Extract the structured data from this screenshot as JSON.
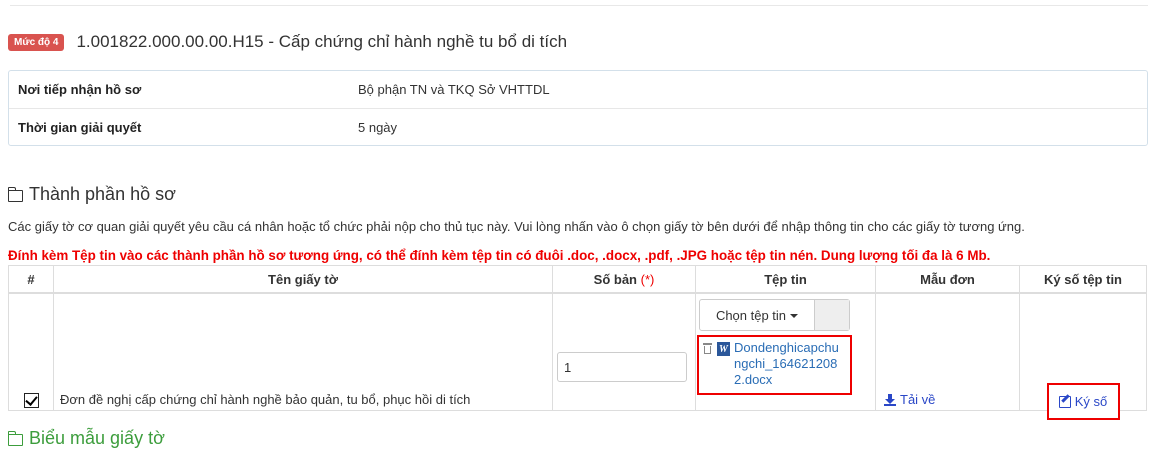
{
  "level_badge": "Mức độ 4",
  "procedure_title": "1.001822.000.00.00.H15 - Cấp chứng chỉ hành nghề tu bổ di tích",
  "info": [
    {
      "label": "Nơi tiếp nhận hồ sơ",
      "value": "Bộ phận TN và TKQ Sở VHTTDL"
    },
    {
      "label": "Thời gian giải quyết",
      "value": "5 ngày"
    }
  ],
  "section_components": "Thành phần hồ sơ",
  "description": "Các giấy tờ cơ quan giải quyết yêu cầu cá nhân hoặc tổ chức phải nộp cho thủ tục này. Vui lòng nhấn vào ô chọn giấy tờ bên dưới để nhập thông tin cho các giấy tờ tương ứng.",
  "warning": "Đính kèm Tệp tin vào các thành phần hồ sơ tương ứng, có thể đính kèm tệp tin có đuôi .doc, .docx, .pdf, .JPG hoặc tệp tin nén. Dung lượng tối đa là 6 Mb.",
  "table": {
    "headers": {
      "num": "#",
      "name": "Tên giấy tờ",
      "copies": "Số bản",
      "required_mark": "(*)",
      "file": "Tệp tin",
      "template": "Mẫu đơn",
      "sign": "Ký số tệp tin"
    },
    "row": {
      "checked": true,
      "name": "Đơn đề nghị cấp chứng chỉ hành nghề bảo quản, tu bổ, phục hồi di tích",
      "copies": "1",
      "choose_file_label": "Chọn tệp tin",
      "file_name": "Dondenghicapchungchi_1646212082.docx",
      "download_label": "Tải về",
      "sign_label": "Ký số"
    }
  },
  "section_forms": "Biểu mẫu giấy tờ",
  "colors": {
    "badge": "#d9534f",
    "warning": "#ee0000",
    "link": "#2a47c7",
    "highlight_border": "#ee0000",
    "section_forms": "#3c9d3c"
  }
}
